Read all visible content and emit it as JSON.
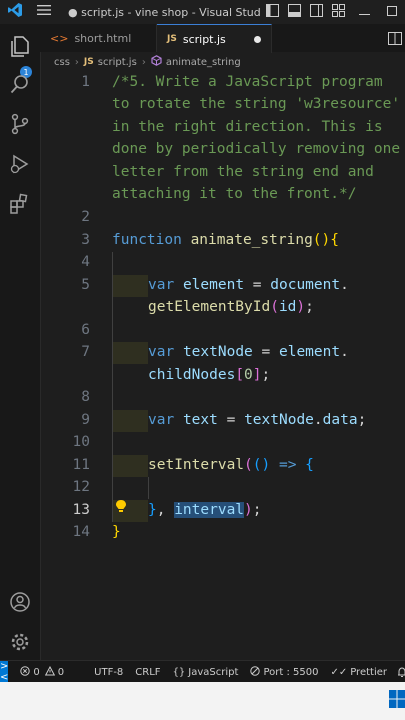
{
  "titlebar": {
    "title": "● script.js - vine shop - Visual Studi..."
  },
  "explorer_badge": "1",
  "tabs": [
    {
      "label": "short.html",
      "type": "html"
    },
    {
      "label": "script.js",
      "type": "js",
      "modified": true
    }
  ],
  "breadcrumb": {
    "folder": "css",
    "file": "script.js",
    "symbol": "animate_string",
    "js_badge": "JS"
  },
  "editor": {
    "line_numbers": [
      "1",
      "2",
      "3",
      "4",
      "5",
      "6",
      "7",
      "8",
      "9",
      "10",
      "11",
      "12",
      "13",
      "14"
    ],
    "current_line": "13",
    "comment_lines": [
      "/*5. Write a JavaScript program",
      "to rotate the string 'w3resource'",
      "in the right direction. This is",
      "done by periodically removing one",
      "letter from the string end and",
      "attaching it to the front.*/"
    ],
    "tokens": {
      "function_kw": "function",
      "fn_name": "animate_string",
      "var_kw": "var",
      "element": "element",
      "document": "document",
      "getElementById": "getElementById",
      "id": "id",
      "textNode": "textNode",
      "childNodes": "childNodes",
      "zero": "0",
      "text": "text",
      "data": "data",
      "setInterval": "setInterval",
      "arrow": "=>",
      "interval": "interval"
    }
  },
  "statusbar": {
    "remote": "><",
    "errors": "0",
    "warnings": "0",
    "encoding": "UTF-8",
    "eol": "CRLF",
    "language": "JavaScript",
    "port": "Port : 5500",
    "formatter": "Prettier"
  }
}
